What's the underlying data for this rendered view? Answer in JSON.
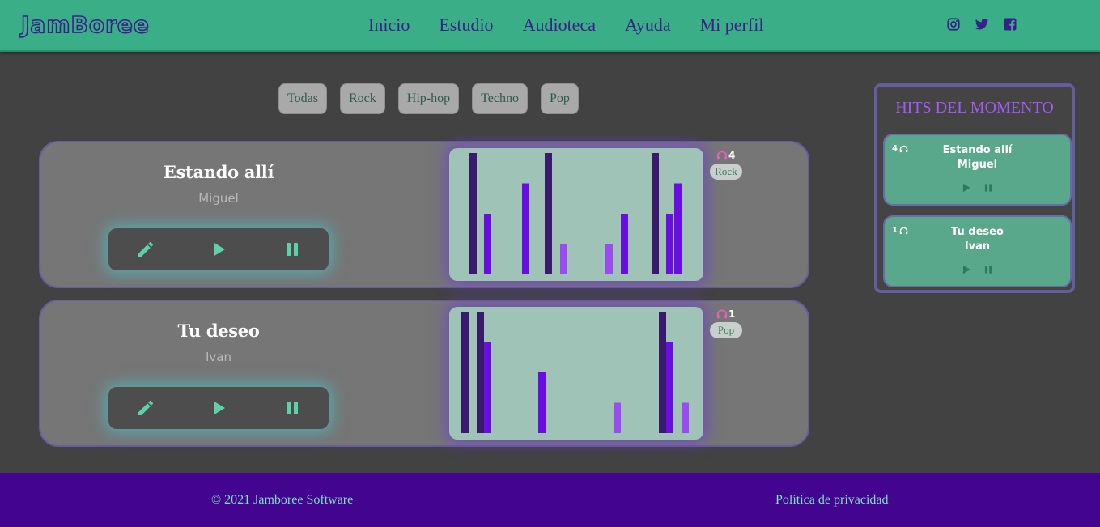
{
  "brand": {
    "logo_text": "JamBoree"
  },
  "nav": {
    "items": [
      {
        "label": "Inicio"
      },
      {
        "label": "Estudio"
      },
      {
        "label": "Audioteca"
      },
      {
        "label": "Ayuda"
      },
      {
        "label": "Mi perfil"
      }
    ]
  },
  "social": [
    "instagram-icon",
    "twitter-icon",
    "facebook-icon"
  ],
  "filters": [
    {
      "label": "Todas"
    },
    {
      "label": "Rock"
    },
    {
      "label": "Hip-hop"
    },
    {
      "label": "Techno"
    },
    {
      "label": "Pop"
    }
  ],
  "songs": [
    {
      "title": "Estando allí",
      "artist": "Miguel",
      "listens": "4",
      "genre": "Rock",
      "visualizer": {
        "levels": [
          1.0,
          0.5,
          0.75,
          1.0,
          0.25,
          0.25,
          0.5,
          1.0,
          0.5,
          0.75
        ],
        "shades": [
          "#3b1a6e",
          "#6a0de0",
          "#6a0de0",
          "#3b1a6e",
          "#9a4cf2",
          "#9a4cf2",
          "#6a0de0",
          "#3b1a6e",
          "#6a0de0",
          "#6a0de0"
        ]
      }
    },
    {
      "title": "Tu deseo",
      "artist": "Ivan",
      "listens": "1",
      "genre": "Pop",
      "visualizer": {
        "levels": [
          1.0,
          1.0,
          0.75,
          0.5,
          0.25,
          1.0,
          0.75,
          0.25
        ],
        "shades": [
          "#3b1a6e",
          "#3b1a6e",
          "#6a0de0",
          "#6a0de0",
          "#9a4cf2",
          "#3b1a6e",
          "#6a0de0",
          "#9a4cf2"
        ]
      }
    }
  ],
  "hits": {
    "title": "HITS DEL MOMENTO",
    "items": [
      {
        "count": "4",
        "title": "Estando allí",
        "artist": "Miguel"
      },
      {
        "count": "1",
        "title": "Tu deseo",
        "artist": "Ivan"
      }
    ]
  },
  "footer": {
    "copyright": "© 2021 Jamboree Software",
    "privacy": "Política de privacidad"
  },
  "colors": {
    "header": "#39ae87",
    "background": "#424242",
    "footer": "#43058f",
    "accent_purple": "#a15cf0",
    "control_glow": "#40d6dc"
  }
}
